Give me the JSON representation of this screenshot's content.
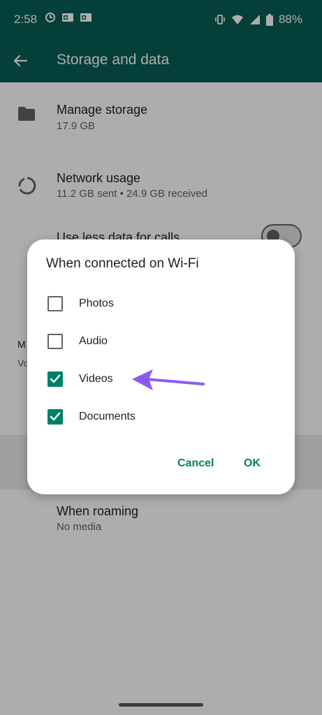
{
  "status_bar": {
    "time": "2:58",
    "battery_pct": "88%",
    "icons_left": [
      "data-saver-icon",
      "outlook-icon",
      "outlook-icon"
    ],
    "icons_right": [
      "vibrate-icon",
      "wifi-icon",
      "signal-icon",
      "battery-icon"
    ]
  },
  "app_bar": {
    "title": "Storage and data"
  },
  "list": {
    "manage_storage": {
      "title": "Manage storage",
      "subtitle": "17.9 GB"
    },
    "network_usage": {
      "title": "Network usage",
      "subtitle": "11.2 GB sent • 24.9 GB received"
    },
    "use_less_data": {
      "title": "Use less data for calls",
      "toggle_on": false
    },
    "section_title_partial": "M",
    "section_sub_partial": "Vo",
    "when_roaming": {
      "title": "When roaming",
      "subtitle": "No media"
    }
  },
  "dialog": {
    "title": "When connected on Wi-Fi",
    "options": [
      {
        "label": "Photos",
        "checked": false
      },
      {
        "label": "Audio",
        "checked": false
      },
      {
        "label": "Videos",
        "checked": true
      },
      {
        "label": "Documents",
        "checked": true
      }
    ],
    "cancel_label": "Cancel",
    "ok_label": "OK"
  },
  "colors": {
    "app_bar": "#075e54",
    "accent": "#008069",
    "annotation_arrow": "#8a5cf6"
  }
}
